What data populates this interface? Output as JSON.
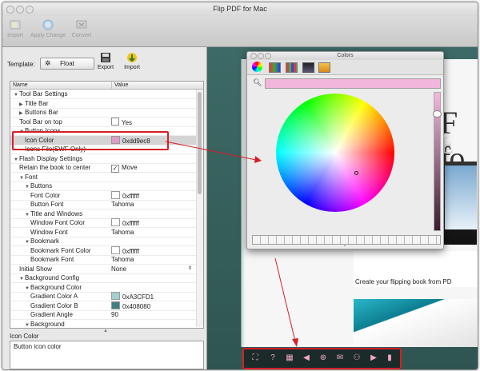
{
  "window": {
    "title": "Flip PDF for Mac"
  },
  "toolbar": {
    "import_label": "Import",
    "apply_label": "Apply Change",
    "convert_label": "Convert"
  },
  "template": {
    "label": "Template:",
    "value": "Float",
    "export_label": "Export",
    "import_label": "Import"
  },
  "table": {
    "columns": [
      "Name",
      "Value"
    ],
    "rows": [
      {
        "name": "Tool Bar Settings",
        "value": "",
        "indent": 0,
        "tri": "down"
      },
      {
        "name": "Title Bar",
        "value": "",
        "indent": 1,
        "tri": "right"
      },
      {
        "name": "Buttons Bar",
        "value": "",
        "indent": 1,
        "tri": "right"
      },
      {
        "name": "Tool Bar on top",
        "value": "Yes",
        "indent": 1,
        "tri": "",
        "control": "checkbox",
        "checked": false
      },
      {
        "name": "Button Icons",
        "value": "",
        "indent": 1,
        "tri": "down"
      },
      {
        "name": "Icon Color",
        "value": "0xdd9ec8",
        "indent": 2,
        "tri": "",
        "control": "swatch",
        "color": "#dd9ec8",
        "selected": true
      },
      {
        "name": "Icons File(SWF Only)",
        "value": "",
        "indent": 2,
        "tri": ""
      },
      {
        "name": "Flash Display Settings",
        "value": "",
        "indent": 0,
        "tri": "down"
      },
      {
        "name": "Retain the book to center",
        "value": "Move",
        "indent": 1,
        "tri": "",
        "control": "checkbox",
        "checked": true
      },
      {
        "name": "Font",
        "value": "",
        "indent": 1,
        "tri": "down"
      },
      {
        "name": "Buttons",
        "value": "",
        "indent": 2,
        "tri": "down"
      },
      {
        "name": "Font Color",
        "value": "0xffffff",
        "indent": 3,
        "tri": "",
        "control": "swatch",
        "color": "#ffffff"
      },
      {
        "name": "Button Font",
        "value": "Tahoma",
        "indent": 3,
        "tri": ""
      },
      {
        "name": "Title and Windows",
        "value": "",
        "indent": 2,
        "tri": "down"
      },
      {
        "name": "Window Font Color",
        "value": "0xffffff",
        "indent": 3,
        "tri": "",
        "control": "swatch",
        "color": "#ffffff"
      },
      {
        "name": "Window Font",
        "value": "Tahoma",
        "indent": 3,
        "tri": ""
      },
      {
        "name": "Bookmark",
        "value": "",
        "indent": 2,
        "tri": "down"
      },
      {
        "name": "Bookmark Font Color",
        "value": "0xffffff",
        "indent": 3,
        "tri": "",
        "control": "swatch",
        "color": "#ffffff"
      },
      {
        "name": "Bookmark Font",
        "value": "Tahoma",
        "indent": 3,
        "tri": ""
      },
      {
        "name": "Initial Show",
        "value": "None",
        "indent": 1,
        "tri": "",
        "control": "select"
      },
      {
        "name": "Background Config",
        "value": "",
        "indent": 1,
        "tri": "down"
      },
      {
        "name": "Background Color",
        "value": "",
        "indent": 2,
        "tri": "down"
      },
      {
        "name": "Gradient Color A",
        "value": "0xA3CFD1",
        "indent": 3,
        "tri": "",
        "control": "swatch",
        "color": "#A3CFD1"
      },
      {
        "name": "Gradient Color B",
        "value": "0x408080",
        "indent": 3,
        "tri": "",
        "control": "swatch",
        "color": "#408080"
      },
      {
        "name": "Gradient Angle",
        "value": "90",
        "indent": 3,
        "tri": ""
      },
      {
        "name": "Background",
        "value": "",
        "indent": 2,
        "tri": "down"
      }
    ]
  },
  "description": {
    "title": "Icon Color",
    "text": "Button icon color"
  },
  "colors_panel": {
    "title": "Colors",
    "selected_color": "#f2b6dc"
  },
  "preview": {
    "heading": "F fo",
    "footer_text": "Create your flipping book from PD"
  },
  "colors": {
    "accent_red": "#d61f26",
    "icon_pink": "#dd9ec8"
  }
}
